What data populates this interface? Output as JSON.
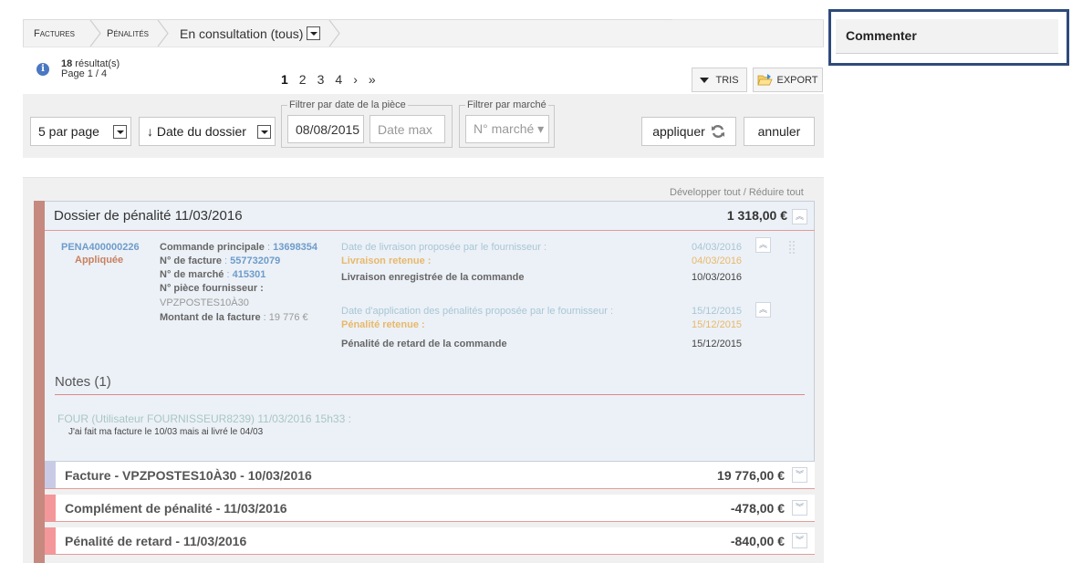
{
  "breadcrumb": {
    "item1": "Factures",
    "item2": "Pénalités",
    "current": "En consultation (tous)"
  },
  "comment_panel": {
    "title": "Commenter"
  },
  "results": {
    "count": "18",
    "count_suffix": " résultat(s)",
    "page": "Page 1 / 4"
  },
  "pager": {
    "pages": [
      "1",
      "2",
      "3",
      "4"
    ],
    "next": "›",
    "last": "»"
  },
  "toolbar": {
    "tris": "TRIS",
    "export": "EXPORT"
  },
  "filters": {
    "per_page": "5 par page",
    "sort": "↓ Date du dossier",
    "date_legend": "Filtrer par date de la pièce",
    "date_min": "08/08/2015",
    "date_max_placeholder": "Date max",
    "market_legend": "Filtrer par marché",
    "market_placeholder": "N° marché ▾",
    "apply": "appliquer",
    "cancel": "annuler"
  },
  "toggle_all": "Développer tout / Réduire tout",
  "dossier": {
    "title": "Dossier de pénalité 11/03/2016",
    "amount": "1 318,00 €",
    "ref": "PENA400000226",
    "status": "Appliquée",
    "main_order_label": "Commande principale",
    "main_order_value": "13698354",
    "invoice_label": "N° de facture",
    "invoice_value": "557732079",
    "market_label": "N° de marché",
    "market_value": "415301",
    "supplier_piece_label": "N° pièce fournisseur :",
    "supplier_piece_value": "VPZPOSTES10À30",
    "invoice_amount_label": "Montant de la facture",
    "invoice_amount_value": "19 776 €",
    "delivery_proposed_label": "Date de livraison proposée par le fournisseur :",
    "delivery_proposed_value": "04/03/2016",
    "delivery_retained_label": "Livraison retenue :",
    "delivery_retained_value": "04/03/2016",
    "delivery_recorded_label": "Livraison enregistrée de la commande",
    "delivery_recorded_value": "10/03/2016",
    "penalty_date_proposed_label": "Date d'application des pénalités proposée par le fournisseur :",
    "penalty_date_proposed_value": "15/12/2015",
    "penalty_retained_label": "Pénalité retenue :",
    "penalty_retained_value": "15/12/2015",
    "late_penalty_label": "Pénalité de retard de la commande",
    "late_penalty_value": "15/12/2015"
  },
  "notes": {
    "title": "Notes (1)",
    "author": "FOUR (Utilisateur FOURNISSEUR8239) 11/03/2016 15h33 :",
    "text": "J'ai fait ma facture le 10/03 mais ai livré le 04/03"
  },
  "subrows": [
    {
      "title": "Facture - VPZPOSTES10À30 - 10/03/2016",
      "amount": "19 776,00 €",
      "color": "#c9cbe6"
    },
    {
      "title": "Complément de pénalité - 11/03/2016",
      "amount": "-478,00 €",
      "color": "#f4979a"
    },
    {
      "title": "Pénalité de retard - 11/03/2016",
      "amount": "-840,00 €",
      "color": "#f4979a"
    }
  ]
}
